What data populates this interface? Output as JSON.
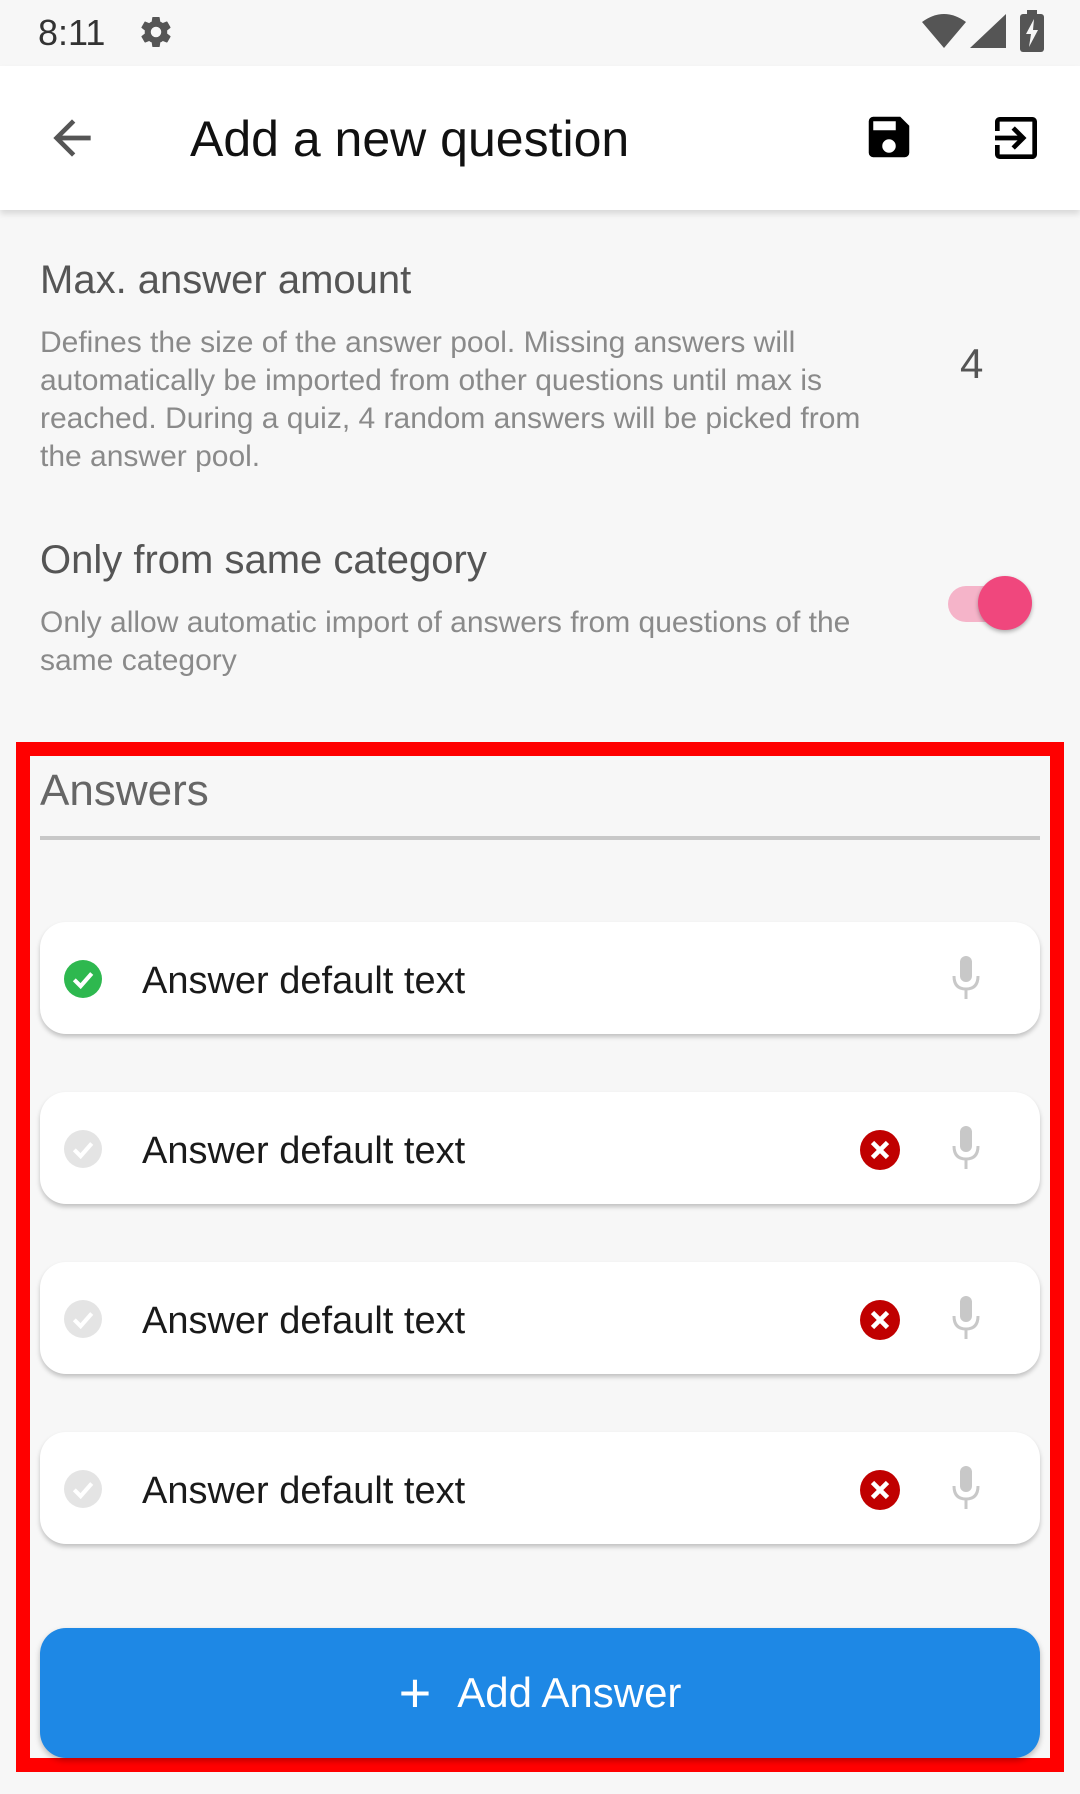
{
  "status_bar": {
    "time": "8:11",
    "icons": [
      "gear-icon",
      "wifi-icon",
      "cell-signal-icon",
      "battery-charging-icon"
    ]
  },
  "app_bar": {
    "title": "Add a new question",
    "back_icon": "arrow-back-icon",
    "save_icon": "save-icon",
    "exit_icon": "exit-icon"
  },
  "settings": {
    "max_answer": {
      "title": "Max. answer amount",
      "description": "Defines the size of the answer pool. Missing answers will automatically be imported from other questions until max is reached. During a quiz, 4 random answers will be picked from the answer pool.",
      "value": "4"
    },
    "same_category": {
      "title": "Only from same category",
      "description": "Only allow automatic import of answers from questions of the same category",
      "enabled": true
    }
  },
  "answers": {
    "title": "Answers",
    "items": [
      {
        "text": "Answer default text",
        "correct": true,
        "removable": false
      },
      {
        "text": "Answer default text",
        "correct": false,
        "removable": true
      },
      {
        "text": "Answer default text",
        "correct": false,
        "removable": true
      },
      {
        "text": "Answer default text",
        "correct": false,
        "removable": true
      }
    ],
    "add_label": "Add Answer"
  },
  "colors": {
    "accent": "#1e88e5",
    "toggle": "#f0477d",
    "correct": "#2eb84f",
    "remove": "#c00000",
    "highlight": "#ff0000"
  }
}
